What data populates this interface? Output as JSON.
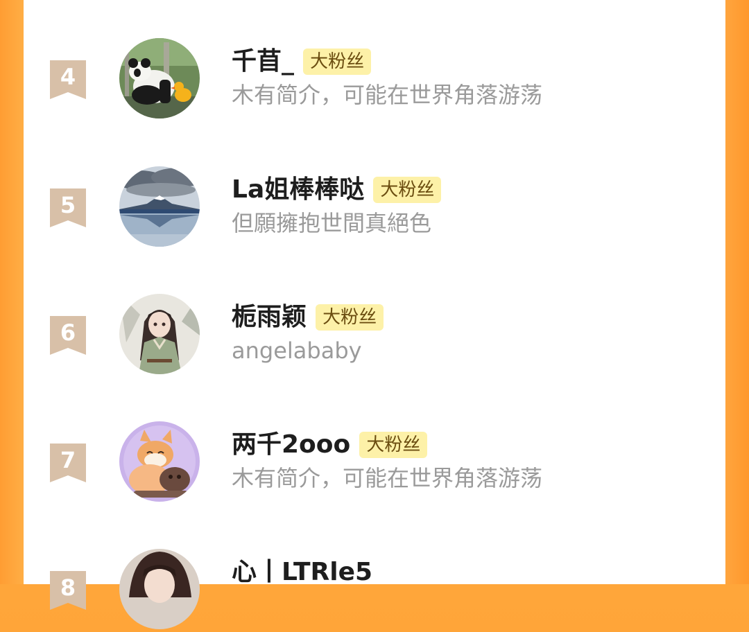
{
  "list": {
    "items": [
      {
        "rank": "4",
        "name": "千苜_",
        "badge": "大粉丝",
        "bio": "木有简介，可能在世界角落游荡",
        "avatar_icon": "panda-avatar-icon"
      },
      {
        "rank": "5",
        "name": "La姐棒棒哒",
        "badge": "大粉丝",
        "bio": "但願擁抱世間真絕色",
        "avatar_icon": "mountain-avatar-icon"
      },
      {
        "rank": "6",
        "name": "栀雨颖",
        "badge": "大粉丝",
        "bio": "angelababy",
        "avatar_icon": "anime-girl-avatar-icon"
      },
      {
        "rank": "7",
        "name": "两千2ooo",
        "badge": "大粉丝",
        "bio": "木有简介，可能在世界角落游荡",
        "avatar_icon": "fox-avatar-icon"
      },
      {
        "rank": "8",
        "name": "心丨LTRle5",
        "badge": "",
        "bio": "",
        "avatar_icon": "anime-man-avatar-icon"
      }
    ]
  },
  "colors": {
    "background_orange": "#ff9f35",
    "rank_ribbon": "#d8c0a8",
    "badge_bg": "#fdf1a8",
    "badge_text": "#6b4d10",
    "name_text": "#1e1e1e",
    "bio_text": "#9a9a9a"
  }
}
